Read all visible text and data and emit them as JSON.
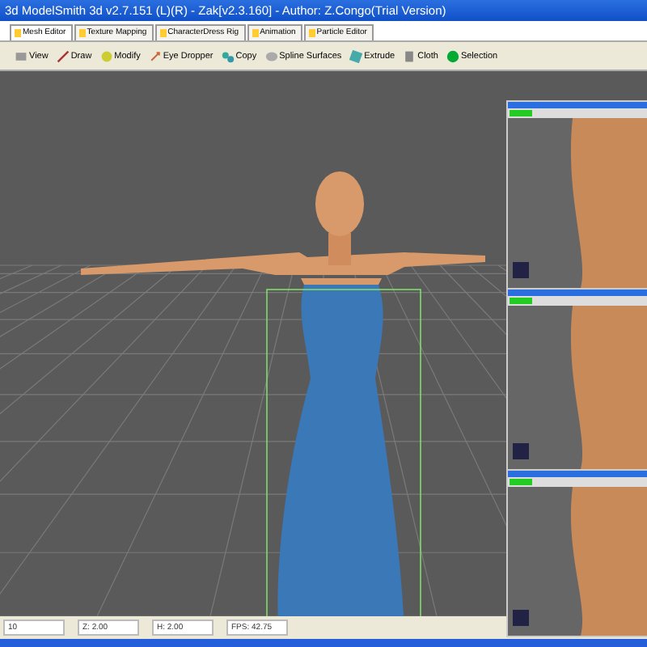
{
  "window": {
    "title": "3d ModelSmith 3d v2.7.151 (L)(R) - Zak[v2.3.160] - Author: Z.Congo(Trial Version)"
  },
  "tabs": [
    {
      "label": "Mesh Editor",
      "selected": true
    },
    {
      "label": "Texture Mapping",
      "selected": false
    },
    {
      "label": "CharacterDress Rig",
      "selected": false
    },
    {
      "label": "Animation",
      "selected": false
    },
    {
      "label": "Particle Editor",
      "selected": false
    }
  ],
  "toolbar": [
    {
      "label": "View"
    },
    {
      "label": "Draw"
    },
    {
      "label": "Modify"
    },
    {
      "label": "Eye Dropper"
    },
    {
      "label": "Copy"
    },
    {
      "label": "Spline Surfaces"
    },
    {
      "label": "Extrude"
    },
    {
      "label": "Cloth"
    },
    {
      "label": "Selection"
    }
  ],
  "status_bar": {
    "fields": [
      "10",
      "Z: 2.00",
      "H: 2.00",
      "FPS: 42.75"
    ]
  }
}
